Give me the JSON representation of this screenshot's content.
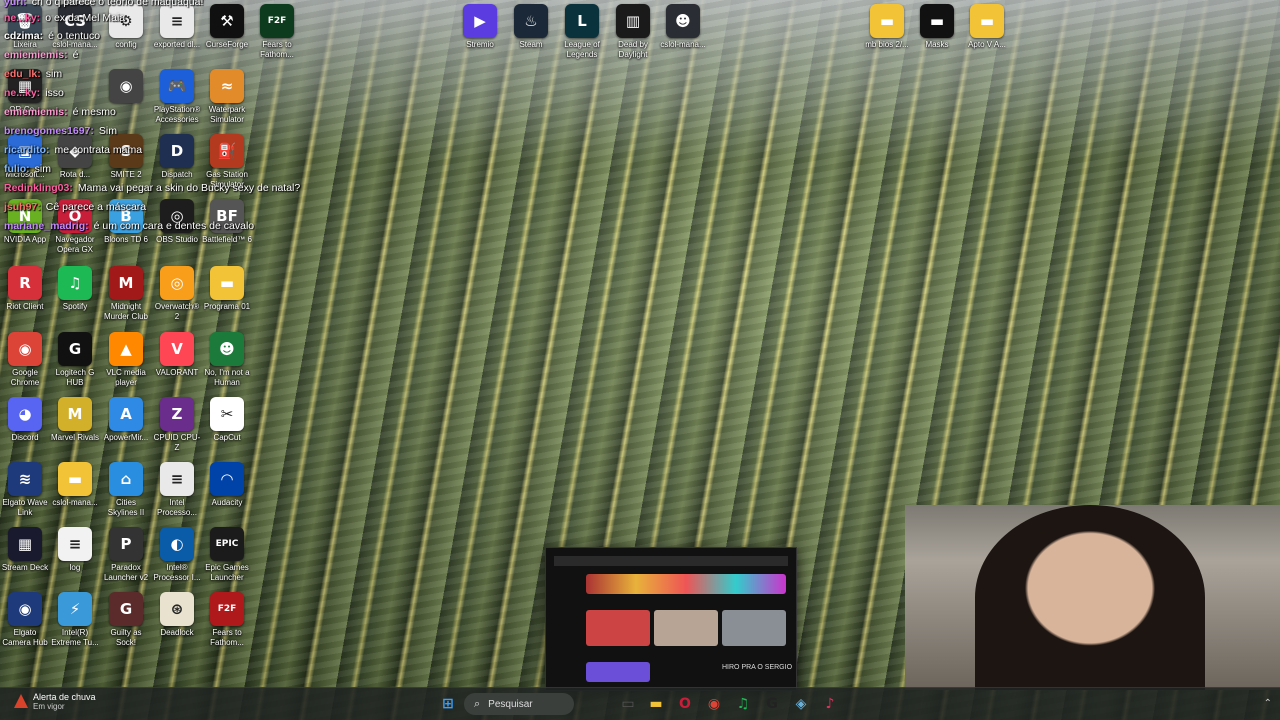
{
  "wallpaper": {
    "subject": "snake plant leaves"
  },
  "icons": [
    {
      "name": "lixeira-icon",
      "label": "Lixeira",
      "color": "#3b4a56",
      "glyph": "🗑"
    },
    {
      "name": "cslol-manager-icon",
      "label": "cslol-mana...",
      "color": "#2a2d33",
      "glyph": "CS"
    },
    {
      "name": "config-icon",
      "label": "config",
      "color": "#e9e9e9",
      "glyph": "⚙"
    },
    {
      "name": "exported-icon",
      "label": "exported dl...",
      "color": "#e9e9e9",
      "glyph": "≡"
    },
    {
      "name": "curseforge-icon",
      "label": "CurseForge",
      "color": "#101010",
      "glyph": "⚒"
    },
    {
      "name": "fears-to-fathom-icon",
      "label": "Fears to Fathom...",
      "color": "#0c3b1d",
      "glyph": "F2F"
    },
    {
      "name": "qr-icon",
      "label": "QR-Co...",
      "color": "#222",
      "glyph": "▦"
    },
    {
      "name": "game-icon",
      "label": "",
      "color": "#444",
      "glyph": "◉"
    },
    {
      "name": "playstation-accessories-icon",
      "label": "PlayStation® Accessories",
      "color": "#1c5fd8",
      "glyph": "🎮"
    },
    {
      "name": "waterpark-simulator-icon",
      "label": "Waterpark Simulator",
      "color": "#e28b2a",
      "glyph": "≈"
    },
    {
      "name": "microsoft-icon",
      "label": "Microsoft...",
      "color": "#2a6bd8",
      "glyph": "▣"
    },
    {
      "name": "rota-icon",
      "label": "Rota d...",
      "color": "#444",
      "glyph": "◆"
    },
    {
      "name": "smite2-icon",
      "label": "SMITE 2",
      "color": "#5b3a1a",
      "glyph": "S"
    },
    {
      "name": "dispatch-icon",
      "label": "Dispatch",
      "color": "#1f2f52",
      "glyph": "D"
    },
    {
      "name": "gas-station-icon",
      "label": "Gas Station Simulator",
      "color": "#b33a1e",
      "glyph": "⛽"
    },
    {
      "name": "nvidia-app-icon",
      "label": "NVIDIA App",
      "color": "#6ab023",
      "glyph": "N"
    },
    {
      "name": "navegador-opera-gx-icon",
      "label": "Navegador Opera GX",
      "color": "#c81e3a",
      "glyph": "O"
    },
    {
      "name": "bloons-td6-icon",
      "label": "Bloons TD 6",
      "color": "#3aa0e0",
      "glyph": "B"
    },
    {
      "name": "obs-studio-icon",
      "label": "OBS Studio",
      "color": "#1d1d1d",
      "glyph": "◎"
    },
    {
      "name": "battlefield6-icon",
      "label": "Battlefield™ 6",
      "color": "#555",
      "glyph": "BF"
    },
    {
      "name": "riot-client-icon",
      "label": "Riot Client",
      "color": "#d6303a",
      "glyph": "R"
    },
    {
      "name": "spotify-icon",
      "label": "Spotify",
      "color": "#1db954",
      "glyph": "♫"
    },
    {
      "name": "midnight-murder-club-icon",
      "label": "Midnight Murder Club",
      "color": "#a21919",
      "glyph": "M"
    },
    {
      "name": "overwatch2-icon",
      "label": "Overwatch® 2",
      "color": "#f99e1a",
      "glyph": "◎"
    },
    {
      "name": "programa01-folder-icon",
      "label": "Programa 01",
      "color": "#f2c237",
      "glyph": "▬"
    },
    {
      "name": "google-chrome-icon",
      "label": "Google Chrome",
      "color": "#db4437",
      "glyph": "◉"
    },
    {
      "name": "logitech-ghub-icon",
      "label": "Logitech G HUB",
      "color": "#111",
      "glyph": "G"
    },
    {
      "name": "vlc-icon",
      "label": "VLC media player",
      "color": "#ff8800",
      "glyph": "▲"
    },
    {
      "name": "valorant-icon",
      "label": "VALORANT",
      "color": "#ff4655",
      "glyph": "V"
    },
    {
      "name": "no-im-not-a-human-icon",
      "label": "No, I'm not a Human",
      "color": "#1c7a3a",
      "glyph": "☻"
    },
    {
      "name": "discord-icon",
      "label": "Discord",
      "color": "#5865f2",
      "glyph": "◕"
    },
    {
      "name": "marvel-rivals-icon",
      "label": "Marvel Rivals",
      "color": "#d3b02a",
      "glyph": "M"
    },
    {
      "name": "apowermirror-icon",
      "label": "ApowerMir...",
      "color": "#2f8ae6",
      "glyph": "A"
    },
    {
      "name": "cpuid-icon",
      "label": "CPUID CPU-Z",
      "color": "#6b2d8c",
      "glyph": "Z"
    },
    {
      "name": "capcut-icon",
      "label": "CapCut",
      "color": "#fff",
      "glyph": "✂"
    },
    {
      "name": "elgato-wave-link-icon",
      "label": "Elgato Wave Link",
      "color": "#1e3a7a",
      "glyph": "≋"
    },
    {
      "name": "cslol-folder-icon",
      "label": "cslol-mana...",
      "color": "#f2c237",
      "glyph": "▬"
    },
    {
      "name": "cities-skylines-icon",
      "label": "Cities Skylines II",
      "color": "#2a8ee0",
      "glyph": "⌂"
    },
    {
      "name": "intel-processor-icon",
      "label": "Intel Processo...",
      "color": "#e9e9e9",
      "glyph": "≡"
    },
    {
      "name": "audacity-icon",
      "label": "Audacity",
      "color": "#0043a8",
      "glyph": "◠"
    },
    {
      "name": "stream-deck-icon",
      "label": "Stream Deck",
      "color": "#1a1a2e",
      "glyph": "▦"
    },
    {
      "name": "log-icon",
      "label": "log",
      "color": "#f2f2f2",
      "glyph": "≡"
    },
    {
      "name": "paradox-launcher-icon",
      "label": "Paradox Launcher v2",
      "color": "#333",
      "glyph": "P"
    },
    {
      "name": "intel-processor-id-icon",
      "label": "Intel® Processor I...",
      "color": "#0a5ca8",
      "glyph": "◐"
    },
    {
      "name": "epic-games-icon",
      "label": "Epic Games Launcher",
      "color": "#1b1b1b",
      "glyph": "EPIC"
    },
    {
      "name": "elgato-camera-hub-icon",
      "label": "Elgato Camera Hub",
      "color": "#1e3a7a",
      "glyph": "◉"
    },
    {
      "name": "intel-extreme-icon",
      "label": "Intel(R) Extreme Tu...",
      "color": "#3a9ad9",
      "glyph": "⚡"
    },
    {
      "name": "guilty-as-sock-icon",
      "label": "Guilty as Sock!",
      "color": "#5b2a2a",
      "glyph": "G"
    },
    {
      "name": "deadlock-icon",
      "label": "Deadlock",
      "color": "#e8e2cf",
      "glyph": "⊛"
    },
    {
      "name": "fears-to-fathom2-icon",
      "label": "Fears to Fathom...",
      "color": "#b0191c",
      "glyph": "F2F"
    },
    {
      "name": "stremio-icon",
      "label": "Stremio",
      "color": "#5b3ce0",
      "glyph": "▶"
    },
    {
      "name": "steam-icon",
      "label": "Steam",
      "color": "#1b2838",
      "glyph": "♨"
    },
    {
      "name": "league-of-legends-icon",
      "label": "League of Legends",
      "color": "#0a323c",
      "glyph": "L"
    },
    {
      "name": "dead-by-daylight-icon",
      "label": "Dead by Daylight",
      "color": "#1a1a1a",
      "glyph": "▥"
    },
    {
      "name": "cslol-manager2-icon",
      "label": "cslol-mana...",
      "color": "#2a2d33",
      "glyph": "☻"
    },
    {
      "name": "mb-bios-folder-icon",
      "label": "mb bios 2/...",
      "color": "#f2c237",
      "glyph": "▬"
    },
    {
      "name": "masks-icon",
      "label": "Masks",
      "color": "#111",
      "glyph": "▬"
    },
    {
      "name": "apto-folder-icon",
      "label": "Apto V A...",
      "color": "#f2c237",
      "glyph": "▬"
    }
  ],
  "chat": [
    {
      "user": "yuri",
      "text": "crl o q parece o teorlo de maquaqua!",
      "color": "#c48cff"
    },
    {
      "user": "ne...ky",
      "text": "o ex da Mel Maia",
      "color": "#ff5fa2"
    },
    {
      "user": "cdzima",
      "text": "é o tentuco",
      "color": "#ffffff"
    },
    {
      "user": "emiemiemis",
      "text": "é",
      "color": "#ff9bd2"
    },
    {
      "user": "edu_lk",
      "text": "sim",
      "color": "#ff7070"
    },
    {
      "user": "ne...ky",
      "text": "isso",
      "color": "#ff5fa2"
    },
    {
      "user": "emiemiemis",
      "text": "é mesmo",
      "color": "#ff9bd2"
    },
    {
      "user": "brenogomes1697",
      "text": "Sim",
      "color": "#c48cff"
    },
    {
      "user": "ricardito",
      "text": "me contrata mama",
      "color": "#7fb7ff"
    },
    {
      "user": "fulio",
      "text": "sim",
      "color": "#7fb7ff"
    },
    {
      "user": "Redinkling03",
      "text": "Mama vai pegar a skin do Bucky sexy de natal?",
      "color": "#ff5fa2"
    },
    {
      "user": "jsuh97",
      "text": "Cê parece a máscara",
      "color": "#ff7070"
    },
    {
      "user": "mariane_madrig",
      "text": "é um com cara e dentes de cavalo",
      "color": "#c48cff"
    }
  ],
  "taskbar": {
    "weather_title": "Alerta de chuva",
    "weather_sub": "Em vigor",
    "search_placeholder": "Pesquisar",
    "apps": [
      {
        "name": "start-button-icon",
        "color": "#3aa0ff",
        "glyph": "⊞"
      },
      {
        "name": "task-view-icon",
        "color": "#555",
        "glyph": "▭"
      },
      {
        "name": "file-explorer-icon",
        "color": "#f2c237",
        "glyph": "▬"
      },
      {
        "name": "opera-gx-taskbar-icon",
        "color": "#c81e3a",
        "glyph": "O"
      },
      {
        "name": "chrome-taskbar-icon",
        "color": "#db4437",
        "glyph": "◉"
      },
      {
        "name": "spotify-taskbar-icon",
        "color": "#1db954",
        "glyph": "♫"
      },
      {
        "name": "ghub-taskbar-icon",
        "color": "#222",
        "glyph": "G"
      },
      {
        "name": "app-taskbar-icon",
        "color": "#6ab0d9",
        "glyph": "◈"
      },
      {
        "name": "music-taskbar-icon",
        "color": "#e0315b",
        "glyph": "♪"
      }
    ]
  },
  "preview": {
    "caption": "HIRO PRA O SERGIO"
  }
}
